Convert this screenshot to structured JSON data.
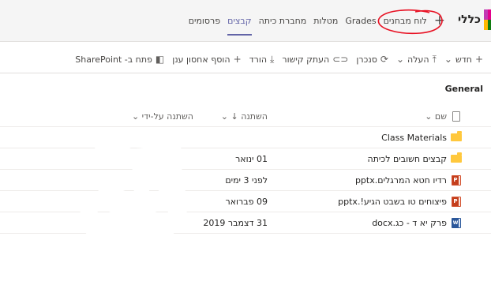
{
  "header": {
    "team_name": "כללי",
    "tabs": [
      {
        "label": "פרסומים",
        "active": false
      },
      {
        "label": "קבצים",
        "active": true
      },
      {
        "label": "מחברת כיתה",
        "active": false
      },
      {
        "label": "מטלות",
        "active": false
      },
      {
        "label": "Grades",
        "active": false
      },
      {
        "label": "לוח מבחנים",
        "active": false
      }
    ],
    "add_tab_label": "+"
  },
  "toolbar": {
    "new_label": "חדש",
    "upload_label": "העלה",
    "sync_label": "סנכרן",
    "copy_link_label": "העתק קישור",
    "download_label": "הורד",
    "add_storage_label": "הוסף אחסון ענן",
    "open_sharepoint_label": "פתח ב- SharePoint",
    "icons": {
      "new": "plus-icon",
      "upload": "upload-icon",
      "sync": "sync-icon",
      "copy_link": "link-icon",
      "download": "download-icon",
      "add_storage": "plus-icon",
      "sharepoint": "sharepoint-icon"
    }
  },
  "folder": {
    "title": "General"
  },
  "table": {
    "columns": {
      "name": "שם",
      "modified": "השתנה",
      "modified_by": "השתנה על-ידי"
    },
    "rows": [
      {
        "type": "folder",
        "name": "Class Materials",
        "modified": ""
      },
      {
        "type": "folder",
        "name": "קבצים חשובים לכיתה",
        "modified": "01 ינואר"
      },
      {
        "type": "ppt",
        "name": "רדיו חטא המרגלים.pptx",
        "modified": "לפני 3 ימים"
      },
      {
        "type": "ppt",
        "name": "פיצוחים טו בשבט הגיע!.pptx",
        "modified": "09 פברואר"
      },
      {
        "type": "word",
        "name": "פרק יא ד - כג.docx",
        "modified": "31 דצמבר 2019"
      }
    ]
  },
  "colors": {
    "accent": "#6264a7",
    "annotation_red": "#e81123",
    "folder_yellow": "#ffc83d",
    "ppt_red": "#c43e1c",
    "word_blue": "#2b579a"
  }
}
